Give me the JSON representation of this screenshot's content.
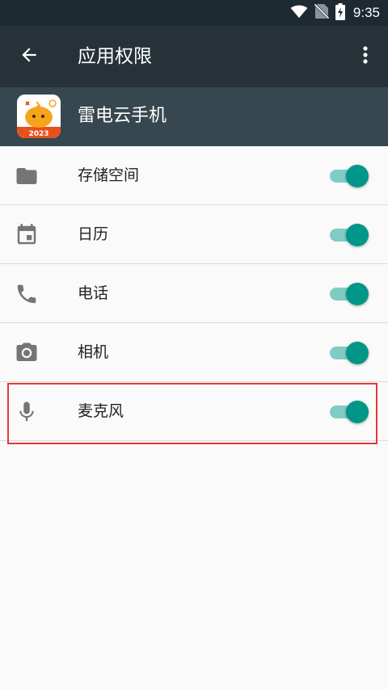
{
  "status_bar": {
    "time": "9:35",
    "icons": [
      "wifi-icon",
      "no-sim-icon",
      "battery-charging-icon"
    ]
  },
  "toolbar": {
    "title": "应用权限",
    "back_icon": "arrow-back-icon",
    "more_icon": "more-vert-icon"
  },
  "app": {
    "name": "雷电云手机",
    "icon_badge": "2023"
  },
  "permissions": [
    {
      "label": "存储空间",
      "icon": "folder-icon",
      "enabled": true
    },
    {
      "label": "日历",
      "icon": "calendar-icon",
      "enabled": true
    },
    {
      "label": "电话",
      "icon": "phone-icon",
      "enabled": true
    },
    {
      "label": "相机",
      "icon": "camera-icon",
      "enabled": true
    },
    {
      "label": "麦克风",
      "icon": "microphone-icon",
      "enabled": true
    }
  ],
  "colors": {
    "toolbar": "#263238",
    "app_header": "#37474f",
    "toggle_on": "#009688",
    "highlight": "#e53935"
  }
}
